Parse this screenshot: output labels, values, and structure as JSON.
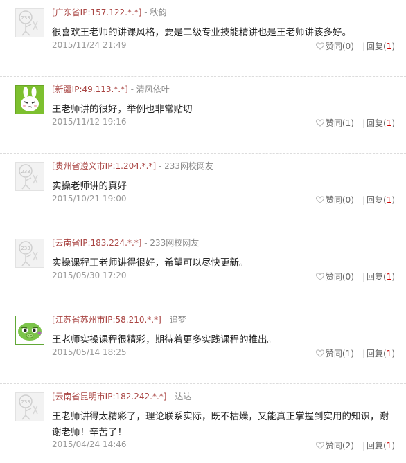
{
  "comments": [
    {
      "location": "[广东省IP:157.122.*.*]",
      "dash": " - ",
      "user": "秋韵",
      "avatar_icon": "default-avatar-icon",
      "text": "很喜欢王老师的讲课风格，要是二级专业技能精讲也是王老师讲该多好。",
      "date": "2015/11/24 21:49",
      "agree_label": "赞同",
      "agree_count": "(0)",
      "reply_label": "回复",
      "reply_open": "(",
      "reply_count": "1",
      "reply_close": ")"
    },
    {
      "location": "[新疆IP:49.113.*.*]",
      "dash": " - ",
      "user": "清风依叶",
      "avatar_icon": "rabbit-avatar-icon",
      "text": "王老师讲的很好，举例也非常贴切",
      "date": "2015/11/12 19:16",
      "agree_label": "赞同",
      "agree_count": "(1)",
      "reply_label": "回复",
      "reply_open": "(",
      "reply_count": "1",
      "reply_close": ")"
    },
    {
      "location": "[贵州省遵义市IP:1.204.*.*]",
      "dash": " - ",
      "user": "233网校网友",
      "avatar_icon": "default-avatar-icon",
      "text": "实操老师讲的真好",
      "date": "2015/10/21 19:00",
      "agree_label": "赞同",
      "agree_count": "(0)",
      "reply_label": "回复",
      "reply_open": "(",
      "reply_count": "1",
      "reply_close": ")"
    },
    {
      "location": "[云南省IP:183.224.*.*]",
      "dash": " - ",
      "user": "233网校网友",
      "avatar_icon": "default-avatar-icon",
      "text": "实操课程王老师讲得很好，希望可以尽快更新。",
      "date": "2015/05/30 17:20",
      "agree_label": "赞同",
      "agree_count": "(0)",
      "reply_label": "回复",
      "reply_open": "(",
      "reply_count": "1",
      "reply_close": ")"
    },
    {
      "location": "[江苏省苏州市IP:58.210.*.*]",
      "dash": " - ",
      "user": "追梦",
      "avatar_icon": "green-pig-avatar-icon",
      "text": "王老师实操课程很精彩，期待着更多实践课程的推出。",
      "date": "2015/05/14 18:25",
      "agree_label": "赞同",
      "agree_count": "(1)",
      "reply_label": "回复",
      "reply_open": "(",
      "reply_count": "1",
      "reply_close": ")"
    },
    {
      "location": "[云南省昆明市IP:182.242.*.*]",
      "dash": " - ",
      "user": "达达",
      "avatar_icon": "default-avatar-icon",
      "text": "王老师讲得太精彩了，理论联系实际，既不枯燥，又能真正掌握到实用的知识，谢谢老师！辛苦了！",
      "date": "2015/04/24 14:46",
      "agree_label": "赞同",
      "agree_count": "(2)",
      "reply_label": "回复",
      "reply_open": "(",
      "reply_count": "1",
      "reply_close": ")"
    }
  ],
  "colors": {
    "location": "#a94442",
    "accent_red": "#cc0000",
    "meta_gray": "#888888",
    "border": "#dcdcdc"
  }
}
